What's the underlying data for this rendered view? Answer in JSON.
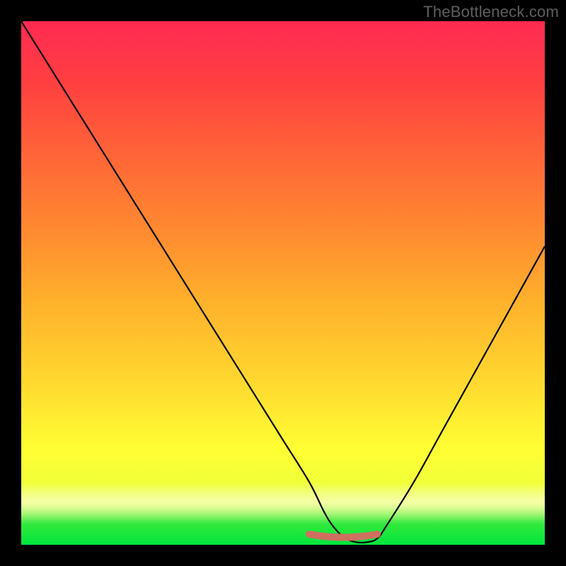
{
  "watermark": "TheBottleneck.com",
  "chart_data": {
    "type": "line",
    "title": "",
    "xlabel": "",
    "ylabel": "",
    "xlim": [
      0,
      100
    ],
    "ylim": [
      0,
      100
    ],
    "grid": false,
    "legend": false,
    "x": [
      0,
      5,
      10,
      15,
      20,
      25,
      30,
      35,
      40,
      45,
      50,
      55,
      58,
      60,
      62,
      64,
      66,
      68,
      70,
      75,
      80,
      85,
      90,
      95,
      100
    ],
    "values": [
      100,
      92,
      84,
      76,
      68,
      60,
      52,
      44,
      36,
      28,
      20,
      12,
      6,
      3,
      1.2,
      0.5,
      0.5,
      1.2,
      4,
      12,
      21,
      30,
      39,
      48,
      57
    ],
    "annotations": [
      {
        "kind": "rounded-bar",
        "color": "#cf6f60",
        "x_start": 55,
        "x_end": 68,
        "y": 0.5
      }
    ]
  }
}
